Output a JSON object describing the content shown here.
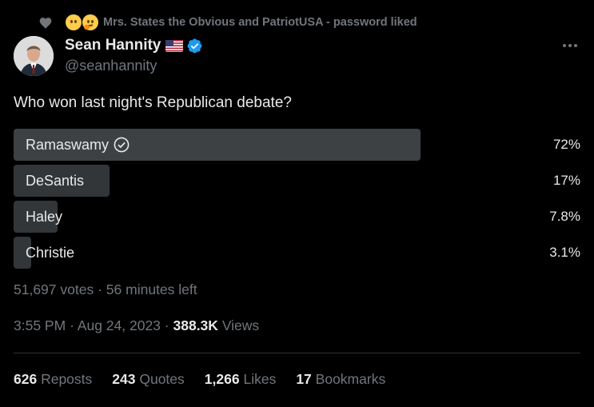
{
  "social_context": {
    "icon": "heart-icon",
    "text": "Mrs. States the Obvious and PatriotUSA - password liked"
  },
  "author": {
    "display_name": "Sean Hannity",
    "handle": "@seanhannity",
    "flag_icon": "us-flag-icon",
    "verified": true,
    "verified_color": "#1d9bf0"
  },
  "tweet": {
    "text": "Who won last night's Republican debate?"
  },
  "poll": {
    "options": [
      {
        "label": "Ramaswamy",
        "percent_text": "72%",
        "fraction": 0.72,
        "winner": true
      },
      {
        "label": "DeSantis",
        "percent_text": "17%",
        "fraction": 0.17,
        "winner": false
      },
      {
        "label": "Haley",
        "percent_text": "7.8%",
        "fraction": 0.078,
        "winner": false
      },
      {
        "label": "Christie",
        "percent_text": "3.1%",
        "fraction": 0.031,
        "winner": false
      }
    ],
    "votes": "51,697 votes",
    "separator": "·",
    "time_left": "56 minutes left"
  },
  "timestamp": {
    "time": "3:55 PM",
    "separator": "·",
    "date": "Aug 24, 2023",
    "views_count": "388.3K",
    "views_label": "Views"
  },
  "stats": {
    "reposts": {
      "count": "626",
      "label": "Reposts"
    },
    "quotes": {
      "count": "243",
      "label": "Quotes"
    },
    "likes": {
      "count": "1,266",
      "label": "Likes"
    },
    "bookmarks": {
      "count": "17",
      "label": "Bookmarks"
    }
  },
  "colors": {
    "background": "#000000",
    "text_primary": "#e7e9ea",
    "text_secondary": "#71767b",
    "poll_bar": "#333639",
    "poll_bar_winner": "#3e4144"
  }
}
